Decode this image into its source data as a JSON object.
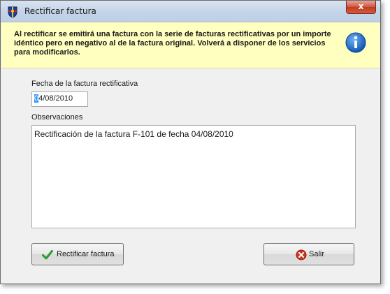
{
  "window": {
    "title": "Rectificar factura",
    "close_label": "x"
  },
  "info": {
    "message": "Al rectificar se emitirá una factura con la serie de facturas rectificativas por un importe idéntico pero en negativo al de la factura original. Volverá a disponer de los servicios para modificarlos.",
    "icon": "info-icon"
  },
  "form": {
    "date_label": "Fecha de la factura rectificativa",
    "date_value_first": "0",
    "date_value_rest": "4/08/2010",
    "obs_label": "Observaciones",
    "obs_value": "Rectificación de la factura F-101 de fecha 04/08/2010"
  },
  "buttons": {
    "rectify_label": "Rectificar factura",
    "exit_label": "Salir"
  },
  "colors": {
    "banner": "#ffffc0",
    "info_icon": "#1c6fd1",
    "check": "#2e9a2e",
    "exit_icon": "#d0341f"
  }
}
